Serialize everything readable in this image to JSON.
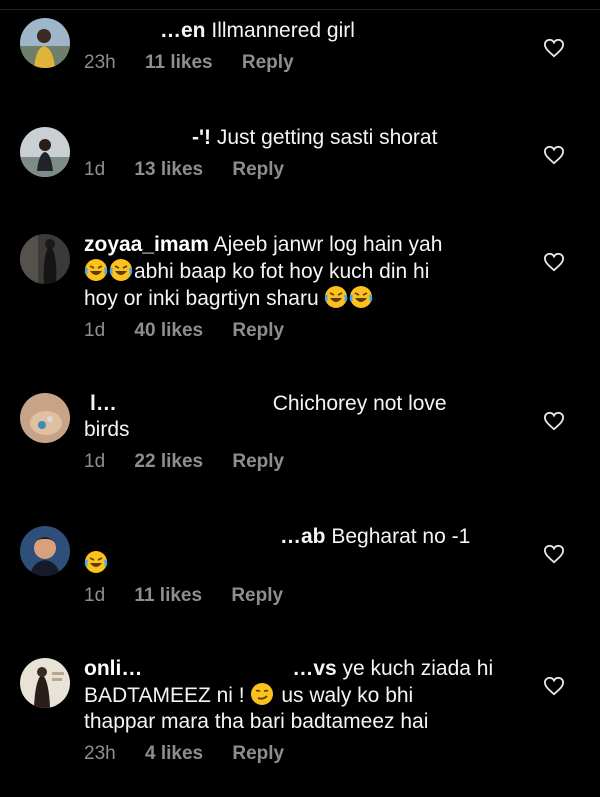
{
  "comments": [
    {
      "username": "",
      "text": "Illmannered girl",
      "partial_username": "…en",
      "time": "23h",
      "likes": "11 likes",
      "reply": "Reply"
    },
    {
      "username": "",
      "partial_username": "-'!",
      "text": "Just getting sasti shorat",
      "time": "1d",
      "likes": "13 likes",
      "reply": "Reply"
    },
    {
      "username": "zoyaa_imam",
      "text": "Ajeeb janwr log hain yah",
      "line2": "abhi baap ko fot hoy kuch din hi",
      "line3": "hoy or inki bagrtiyn sharu",
      "time": "1d",
      "likes": "40 likes",
      "reply": "Reply"
    },
    {
      "username": "",
      "partial_username": "l…",
      "text": "Chichorey not love",
      "line2": "birds",
      "time": "1d",
      "likes": "22 likes",
      "reply": "Reply"
    },
    {
      "username": "",
      "partial_username": "…ab",
      "text": "Begharat no -1",
      "time": "1d",
      "likes": "11 likes",
      "reply": "Reply"
    },
    {
      "username": "onli…",
      "partial_username": "…vs",
      "text": "ye kuch ziada hi",
      "line2": "BADTAMEEZ ni !",
      "line2b": "us waly ko bhi",
      "line3": "thappar mara tha bari badtameez hai",
      "time": "23h",
      "likes": "4 likes",
      "reply": "Reply"
    }
  ],
  "colors": {
    "background": "#000000",
    "text": "#f5f5f5",
    "meta": "#8e8e8e"
  },
  "icons": {
    "like": "heart-outline-icon",
    "laugh": "face-with-tears-of-joy-emoji",
    "smirk": "smirking-face-emoji"
  }
}
